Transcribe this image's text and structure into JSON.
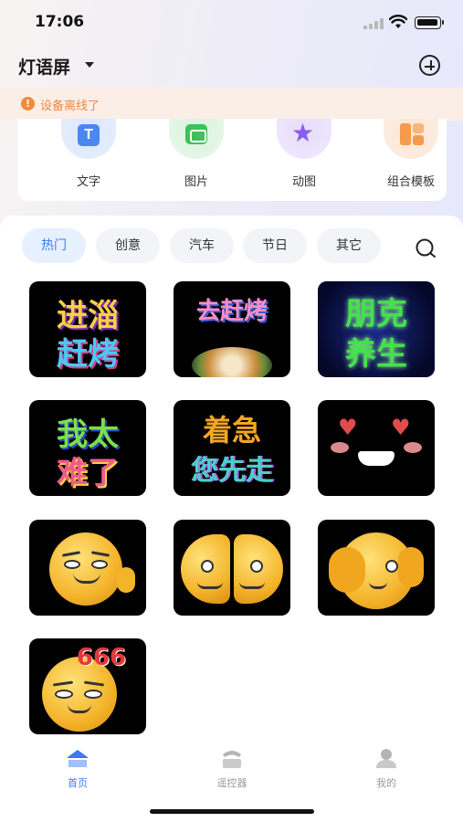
{
  "status_bar": {
    "time": "17:06"
  },
  "header": {
    "device_name": "灯语屏"
  },
  "notice": {
    "text": "设备离线了"
  },
  "functions": [
    {
      "label": "文字",
      "icon": "text-icon"
    },
    {
      "label": "图片",
      "icon": "image-icon"
    },
    {
      "label": "动图",
      "icon": "animation-star-icon"
    },
    {
      "label": "组合模板",
      "icon": "combo-template-icon"
    }
  ],
  "categories": {
    "tabs": [
      {
        "label": "热门",
        "active": true
      },
      {
        "label": "创意",
        "active": false
      },
      {
        "label": "汽车",
        "active": false
      },
      {
        "label": "节日",
        "active": false
      },
      {
        "label": "其它",
        "active": false
      }
    ]
  },
  "tiles": [
    {
      "lines": [
        "进淄",
        "赶烤"
      ]
    },
    {
      "lines": [
        "去赶烤"
      ]
    },
    {
      "lines": [
        "朋克",
        "养生"
      ]
    },
    {
      "lines": [
        "我太",
        "难了"
      ]
    },
    {
      "lines": [
        "着急",
        "您先走"
      ]
    },
    {
      "lines": []
    },
    {
      "lines": []
    },
    {
      "lines": []
    },
    {
      "lines": []
    },
    {
      "lines": [
        "666"
      ]
    }
  ],
  "tabbar": {
    "items": [
      {
        "label": "首页",
        "active": true
      },
      {
        "label": "遥控器",
        "active": false
      },
      {
        "label": "我的",
        "active": false
      }
    ]
  },
  "colors": {
    "accent": "#3b7af5",
    "warning": "#ec8a44",
    "warning_bg": "#fbeee6"
  }
}
